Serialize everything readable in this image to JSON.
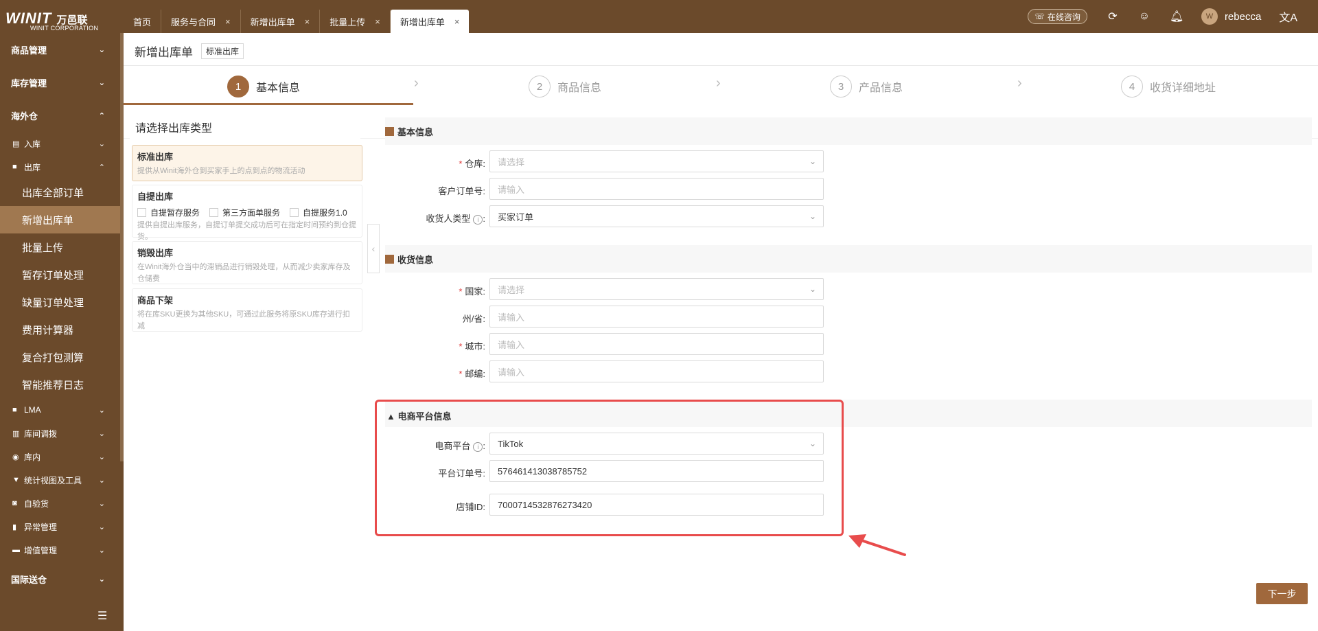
{
  "header": {
    "logo_main": "WINIT",
    "logo_cn": "万邑联",
    "logo_sub": "WINIT CORPORATION",
    "tabs": [
      {
        "label": "首页"
      },
      {
        "label": "服务与合同"
      },
      {
        "label": "新增出库单"
      },
      {
        "label": "批量上传"
      },
      {
        "label": "新增出库单"
      }
    ],
    "close_glyph": "×",
    "consult_label": "在线咨询",
    "username": "rebecca",
    "icons": [
      "refresh-icon",
      "feedback-icon",
      "bell-icon",
      "translate-icon"
    ]
  },
  "sidebar": {
    "groups": [
      {
        "label": "商品管理"
      },
      {
        "label": "库存管理"
      },
      {
        "label": "海外仓"
      }
    ],
    "subs": [
      {
        "label": "入库"
      },
      {
        "label": "出库"
      }
    ],
    "leaves": [
      {
        "label": "出库全部订单"
      },
      {
        "label": "新增出库单"
      },
      {
        "label": "批量上传"
      },
      {
        "label": "暂存订单处理"
      },
      {
        "label": "缺量订单处理"
      },
      {
        "label": "费用计算器"
      },
      {
        "label": "复合打包测算"
      },
      {
        "label": "智能推荐日志"
      }
    ],
    "subs2": [
      {
        "label": "LMA"
      },
      {
        "label": "库间调拨"
      },
      {
        "label": "库内"
      },
      {
        "label": "统计视图及工具"
      },
      {
        "label": "自验货"
      },
      {
        "label": "异常管理"
      },
      {
        "label": "增值管理"
      }
    ],
    "bottom_group": "国际送仓"
  },
  "page": {
    "title": "新增出库单",
    "tag": "标准出库",
    "steps": [
      {
        "num": "1",
        "label": "基本信息"
      },
      {
        "num": "2",
        "label": "商品信息"
      },
      {
        "num": "3",
        "label": "产品信息"
      },
      {
        "num": "4",
        "label": "收货详细地址"
      }
    ],
    "left": {
      "title": "请选择出库类型",
      "cards": [
        {
          "title": "标准出库",
          "desc": "提供从Winit海外仓到买家手上的点到点的物流活动"
        },
        {
          "title": "自提出库",
          "desc": "提供自提出库服务，自提订单提交成功后可在指定时间预约到仓提货。",
          "options": [
            "自提暂存服务",
            "第三方面单服务",
            "自提服务1.0"
          ]
        },
        {
          "title": "销毁出库",
          "desc": "在Winit海外仓当中的滞销品进行销毁处理，从而减少卖家库存及仓储费"
        },
        {
          "title": "商品下架",
          "desc": "将在库SKU更换为其他SKU，可通过此服务将原SKU库存进行扣减"
        }
      ]
    },
    "basic": {
      "title": "基本信息",
      "warehouse_label": "仓库:",
      "warehouse_ph": "请选择",
      "customer_order_label": "客户订单号:",
      "customer_order_ph": "请输入",
      "consignee_type_label": "收货人类型",
      "consignee_type_value": "买家订单"
    },
    "receive": {
      "title": "收货信息",
      "country_label": "国家:",
      "country_ph": "请选择",
      "state_label": "州/省:",
      "state_ph": "请输入",
      "city_label": "城市:",
      "city_ph": "请输入",
      "zip_label": "邮编:",
      "zip_ph": "请输入"
    },
    "ecom": {
      "title": "电商平台信息",
      "platform_label": "电商平台",
      "platform_value": "TikTok",
      "order_label": "平台订单号:",
      "order_value": "576461413038785752",
      "shop_label": "店铺ID:",
      "shop_value": "7000714532876273420"
    },
    "next_button": "下一步",
    "colon": ":"
  }
}
